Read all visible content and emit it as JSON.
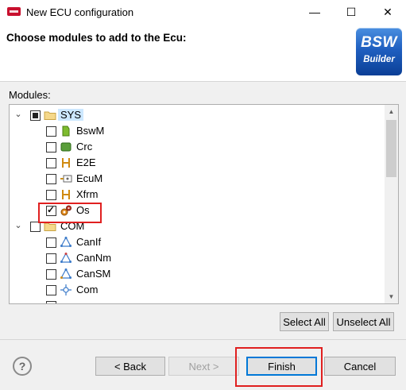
{
  "window": {
    "title": "New ECU configuration",
    "minimize_label": "—",
    "maximize_label": "☐",
    "close_label": "✕"
  },
  "header": {
    "title": "Choose modules to add to the Ecu:",
    "logo_line1": "BSW",
    "logo_line2": "Builder"
  },
  "modules_label": "Modules:",
  "tree": {
    "groups": [
      {
        "label": "SYS",
        "state": "partial",
        "expanded": true,
        "selected": true,
        "items": [
          {
            "label": "BswM",
            "checked": false,
            "icon": "bswm-icon"
          },
          {
            "label": "Crc",
            "checked": false,
            "icon": "crc-icon"
          },
          {
            "label": "E2E",
            "checked": false,
            "icon": "e2e-icon"
          },
          {
            "label": "EcuM",
            "checked": false,
            "icon": "ecum-icon"
          },
          {
            "label": "Xfrm",
            "checked": false,
            "icon": "xfrm-icon"
          },
          {
            "label": "Os",
            "checked": true,
            "icon": "os-gears-icon"
          }
        ]
      },
      {
        "label": "COM",
        "state": "unchecked",
        "expanded": true,
        "items": [
          {
            "label": "CanIf",
            "checked": false,
            "icon": "canif-icon"
          },
          {
            "label": "CanNm",
            "checked": false,
            "icon": "cannm-icon"
          },
          {
            "label": "CanSM",
            "checked": false,
            "icon": "cansm-icon"
          },
          {
            "label": "Com",
            "checked": false,
            "icon": "com-icon"
          }
        ]
      }
    ]
  },
  "buttons": {
    "select_all": "Select All",
    "unselect_all": "Unselect All",
    "back": "< Back",
    "next": "Next >",
    "finish": "Finish",
    "cancel": "Cancel",
    "help": "?"
  },
  "colors": {
    "highlight_red": "#e02020",
    "selection": "#cde8ff",
    "accent": "#0078d7"
  }
}
